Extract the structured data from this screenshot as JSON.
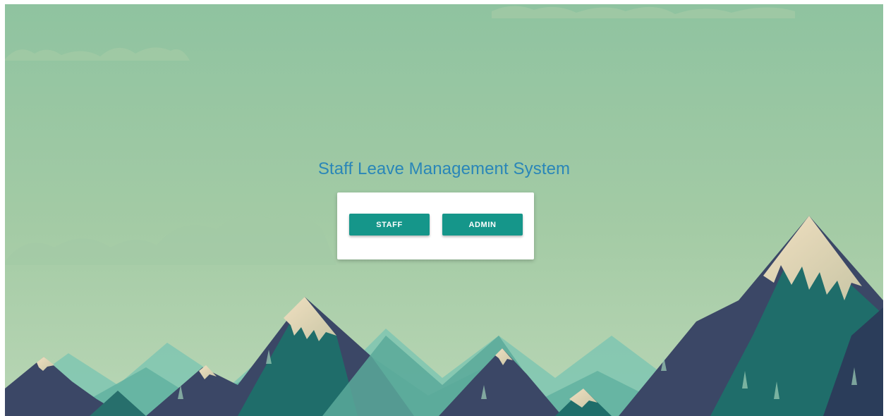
{
  "page": {
    "title": "Staff Leave Management System"
  },
  "login_choice": {
    "staff_label": "STAFF",
    "admin_label": "ADMIN"
  },
  "colors": {
    "title": "#2a86b8",
    "button": "#15968a",
    "sky": "#94c4a2",
    "mountain_dark": "#3b4766",
    "mountain_teal": "#1f6d6a",
    "snow": "#e8d8b8"
  }
}
